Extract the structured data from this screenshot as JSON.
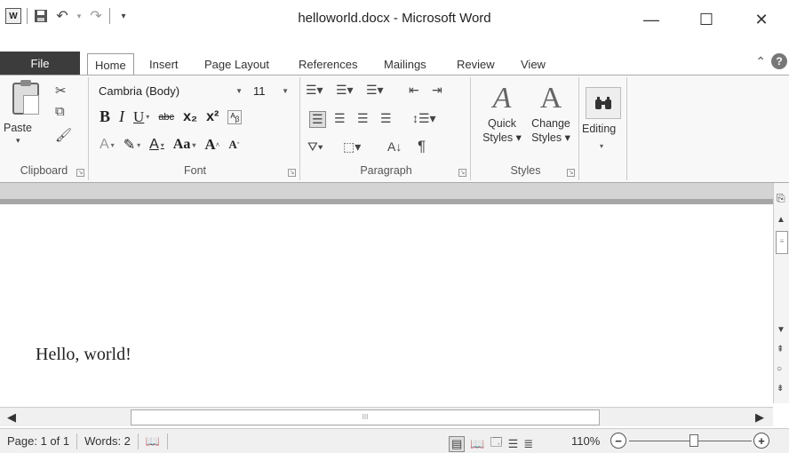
{
  "window": {
    "title": "helloworld.docx - Microsoft Word",
    "minimize_icon": "—",
    "maximize_icon": "☐",
    "close_icon": "✕"
  },
  "qat": {
    "app_icon": "W",
    "save_icon": "💾",
    "undo_icon": "↶",
    "redo_icon": "↷",
    "customize_icon": "▾"
  },
  "tabs": {
    "file": "File",
    "home": "Home",
    "insert": "Insert",
    "page_layout": "Page Layout",
    "references": "References",
    "mailings": "Mailings",
    "review": "Review",
    "view": "View"
  },
  "ribbon": {
    "clipboard": {
      "paste": "Paste",
      "label": "Clipboard"
    },
    "font": {
      "name": "Cambria (Body)",
      "size": "11",
      "bold": "B",
      "italic": "I",
      "underline": "U",
      "strikethrough": "abc",
      "subscript": "x₂",
      "superscript": "x²",
      "change_case": "Aa",
      "grow": "A",
      "shrink": "A",
      "label": "Font"
    },
    "paragraph": {
      "label": "Paragraph",
      "show_marks": "¶"
    },
    "styles": {
      "quick_styles_line1": "Quick",
      "quick_styles_line2": "Styles",
      "change_styles_line1": "Change",
      "change_styles_line2": "Styles",
      "label": "Styles"
    },
    "editing": {
      "label": "Editing"
    }
  },
  "document": {
    "text": "Hello, world!"
  },
  "statusbar": {
    "page": "Page: 1 of 1",
    "words": "Words: 2",
    "zoom": "110%",
    "zoom_out": "−",
    "zoom_in": "+"
  },
  "hscroll": {
    "thumb_grip": "III"
  }
}
